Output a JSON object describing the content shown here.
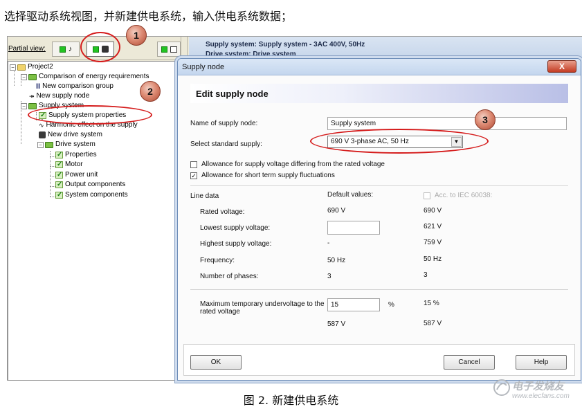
{
  "captions": {
    "top": "选择驱动系统视图，并新建供电系统，输入供电系统数据；",
    "bottom": "图 2.  新建供电系统"
  },
  "watermark": {
    "brand": "电子发烧友",
    "url": "www.elecfans.com"
  },
  "toolbar": {
    "partial_view_label": "Partial view:"
  },
  "header_strip": {
    "line1": "Supply system: Supply system - 3AC 400V, 50Hz",
    "line2": "Drive system: Drive system"
  },
  "tree": {
    "root": "Project2",
    "comparison": "Comparison of energy requirements",
    "new_comparison_group": "New comparison group",
    "new_supply_node": "New supply node",
    "supply_system": "Supply system",
    "supply_system_properties": "Supply system properties",
    "harmonic_effect": "Harmonic effect on the supply",
    "new_drive_system": "New drive system",
    "drive_system": "Drive system",
    "properties": "Properties",
    "motor": "Motor",
    "power_unit": "Power unit",
    "output_components": "Output components",
    "system_components": "System components"
  },
  "dialog": {
    "title": "Supply node",
    "close_label": "X",
    "banner": "Edit supply node",
    "name_label": "Name of supply node:",
    "name_value": "Supply system",
    "std_supply_label": "Select standard supply:",
    "std_supply_value": "690 V 3-phase AC, 50 Hz",
    "allowance_voltage": "Allowance for supply voltage differing from the rated voltage",
    "allowance_voltage_checked": "",
    "allowance_fluct": "Allowance for short term supply fluctuations",
    "allowance_fluct_checked": "✓",
    "line_data": "Line data",
    "default_values": "Default values:",
    "acc_iec": "Acc. to IEC 60038:",
    "rows": [
      {
        "label": "Rated voltage:",
        "default": "690 V",
        "iec": "690 V"
      },
      {
        "label": "Lowest supply voltage:",
        "default": "",
        "iec": "621 V"
      },
      {
        "label": "Highest supply voltage:",
        "default": "-",
        "iec": "759 V"
      },
      {
        "label": "Frequency:",
        "default": "50 Hz",
        "iec": "50 Hz"
      },
      {
        "label": "Number of phases:",
        "default": "3",
        "iec": "3"
      }
    ],
    "undervoltage_label_1": "Maximum temporary undervoltage to the",
    "undervoltage_label_2": "rated voltage",
    "undervoltage_value": "15",
    "undervoltage_unit": "%",
    "undervoltage_iec": "15 %",
    "undervoltage_v_default": "587 V",
    "undervoltage_v_iec": "587 V",
    "ok": "OK",
    "cancel": "Cancel",
    "help": "Help"
  },
  "annotations": {
    "one": "1",
    "two": "2",
    "three": "3"
  },
  "colors": {
    "annotation_red": "#d51c1c",
    "active_green": "#22c322"
  }
}
